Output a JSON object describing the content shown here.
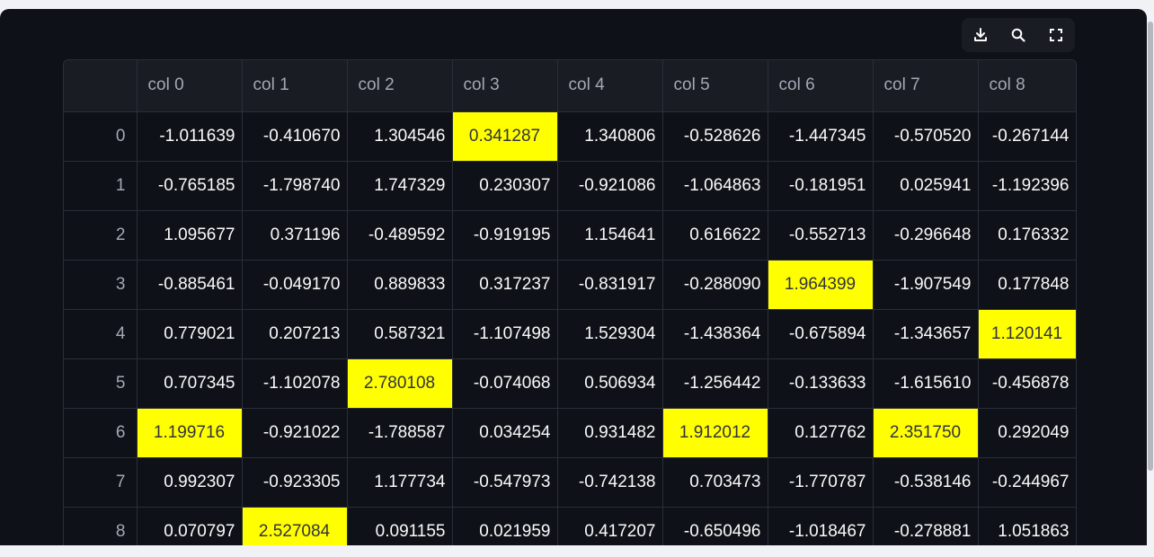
{
  "toolbar": {
    "icons": [
      "download-icon",
      "search-icon",
      "fullscreen-icon"
    ]
  },
  "colors": {
    "highlight": "#ffff00",
    "background": "#0e1117",
    "header_bg": "#1a1c24",
    "border": "#2b2e37"
  },
  "table": {
    "columns": [
      "col 0",
      "col 1",
      "col 2",
      "col 3",
      "col 4",
      "col 5",
      "col 6",
      "col 7",
      "col 8"
    ],
    "rows": [
      {
        "index": "0",
        "values": [
          "-1.011639",
          "-0.410670",
          "1.304546",
          "0.341287",
          "1.340806",
          "-0.528626",
          "-1.447345",
          "-0.570520",
          "-0.267144"
        ],
        "highlight": [
          3
        ]
      },
      {
        "index": "1",
        "values": [
          "-0.765185",
          "-1.798740",
          "1.747329",
          "0.230307",
          "-0.921086",
          "-1.064863",
          "-0.181951",
          "0.025941",
          "-1.192396"
        ],
        "highlight": []
      },
      {
        "index": "2",
        "values": [
          "1.095677",
          "0.371196",
          "-0.489592",
          "-0.919195",
          "1.154641",
          "0.616622",
          "-0.552713",
          "-0.296648",
          "0.176332"
        ],
        "highlight": []
      },
      {
        "index": "3",
        "values": [
          "-0.885461",
          "-0.049170",
          "0.889833",
          "0.317237",
          "-0.831917",
          "-0.288090",
          "1.964399",
          "-1.907549",
          "0.177848"
        ],
        "highlight": [
          6
        ]
      },
      {
        "index": "4",
        "values": [
          "0.779021",
          "0.207213",
          "0.587321",
          "-1.107498",
          "1.529304",
          "-1.438364",
          "-0.675894",
          "-1.343657",
          "1.120141"
        ],
        "highlight": [
          8
        ]
      },
      {
        "index": "5",
        "values": [
          "0.707345",
          "-1.102078",
          "2.780108",
          "-0.074068",
          "0.506934",
          "-1.256442",
          "-0.133633",
          "-1.615610",
          "-0.456878"
        ],
        "highlight": [
          2
        ]
      },
      {
        "index": "6",
        "values": [
          "1.199716",
          "-0.921022",
          "-1.788587",
          "0.034254",
          "0.931482",
          "1.912012",
          "0.127762",
          "2.351750",
          "0.292049"
        ],
        "highlight": [
          0,
          5,
          7
        ]
      },
      {
        "index": "7",
        "values": [
          "0.992307",
          "-0.923305",
          "1.177734",
          "-0.547973",
          "-0.742138",
          "0.703473",
          "-1.770787",
          "-0.538146",
          "-0.244967"
        ],
        "highlight": []
      },
      {
        "index": "8",
        "values": [
          "0.070797",
          "2.527084",
          "0.091155",
          "0.021959",
          "0.417207",
          "-0.650496",
          "-1.018467",
          "-0.278881",
          "1.051863"
        ],
        "highlight": [
          1
        ]
      }
    ]
  }
}
